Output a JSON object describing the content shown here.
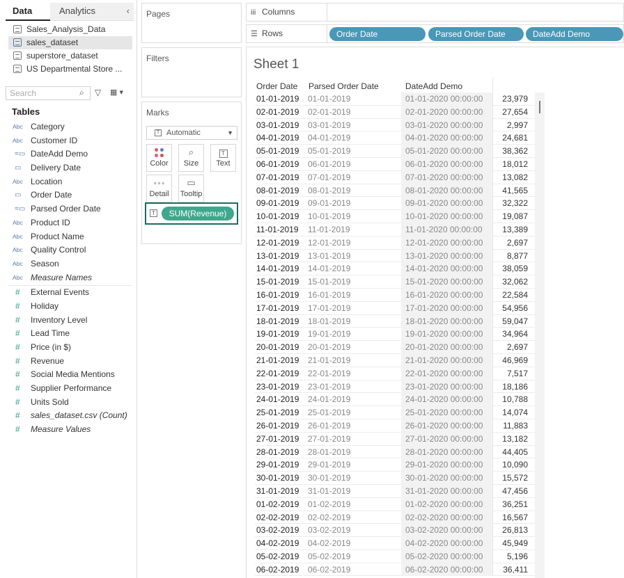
{
  "data_pane": {
    "tab_data": "Data",
    "tab_analytics": "Analytics",
    "collapse_icon": "chevron-left-icon",
    "data_sources": [
      {
        "label": "Sales_Analysis_Data",
        "selected": false
      },
      {
        "label": "sales_dataset",
        "selected": true
      },
      {
        "label": "superstore_dataset",
        "selected": false
      },
      {
        "label": "US Departmental Store ...",
        "selected": false
      }
    ],
    "search_placeholder": "Search",
    "tables_label": "Tables",
    "dimensions": [
      {
        "type": "Abc",
        "label": "Category"
      },
      {
        "type": "Abc",
        "label": "Customer ID"
      },
      {
        "type": "calc-date",
        "label": "DateAdd Demo"
      },
      {
        "type": "date",
        "label": "Delivery Date"
      },
      {
        "type": "Abc",
        "label": "Location"
      },
      {
        "type": "date",
        "label": "Order Date"
      },
      {
        "type": "calc-date",
        "label": "Parsed Order Date"
      },
      {
        "type": "Abc",
        "label": "Product ID"
      },
      {
        "type": "Abc",
        "label": "Product Name"
      },
      {
        "type": "Abc",
        "label": "Quality Control"
      },
      {
        "type": "Abc",
        "label": "Season"
      },
      {
        "type": "Abc",
        "label": "Measure Names",
        "italic": true
      }
    ],
    "measures": [
      {
        "type": "#",
        "label": "External Events"
      },
      {
        "type": "#",
        "label": "Holiday"
      },
      {
        "type": "#",
        "label": "Inventory Level"
      },
      {
        "type": "#",
        "label": "Lead Time"
      },
      {
        "type": "#",
        "label": "Price (in $)"
      },
      {
        "type": "#",
        "label": "Revenue"
      },
      {
        "type": "#",
        "label": "Social Media Mentions"
      },
      {
        "type": "#",
        "label": "Supplier Performance"
      },
      {
        "type": "#",
        "label": "Units Sold"
      },
      {
        "type": "#",
        "label": "sales_dataset.csv (Count)",
        "italic": true
      },
      {
        "type": "#",
        "label": "Measure Values",
        "italic": true
      }
    ]
  },
  "cards": {
    "pages": "Pages",
    "filters": "Filters",
    "marks": "Marks",
    "mark_type": "Automatic",
    "mark_buttons": {
      "color": "Color",
      "size": "Size",
      "text": "Text",
      "detail": "Detail",
      "tooltip": "Tooltip"
    },
    "marks_pill": "SUM(Revenue)"
  },
  "shelves": {
    "columns_label": "Columns",
    "rows_label": "Rows",
    "rows_pills": [
      "Order Date",
      "Parsed Order Date",
      "DateAdd Demo"
    ],
    "pill_color": "#4a97b8"
  },
  "view": {
    "sheet_title": "Sheet 1",
    "headers": [
      "Order Date",
      "Parsed Order Date",
      "DateAdd Demo"
    ],
    "rows": [
      [
        "01-01-2019",
        "01-01-2019",
        "01-01-2020 00:00:00",
        "23,979"
      ],
      [
        "02-01-2019",
        "02-01-2019",
        "02-01-2020 00:00:00",
        "27,654"
      ],
      [
        "03-01-2019",
        "03-01-2019",
        "03-01-2020 00:00:00",
        "2,997"
      ],
      [
        "04-01-2019",
        "04-01-2019",
        "04-01-2020 00:00:00",
        "24,681"
      ],
      [
        "05-01-2019",
        "05-01-2019",
        "05-01-2020 00:00:00",
        "38,362"
      ],
      [
        "06-01-2019",
        "06-01-2019",
        "06-01-2020 00:00:00",
        "18,012"
      ],
      [
        "07-01-2019",
        "07-01-2019",
        "07-01-2020 00:00:00",
        "13,082"
      ],
      [
        "08-01-2019",
        "08-01-2019",
        "08-01-2020 00:00:00",
        "41,565"
      ],
      [
        "09-01-2019",
        "09-01-2019",
        "09-01-2020 00:00:00",
        "32,322"
      ],
      [
        "10-01-2019",
        "10-01-2019",
        "10-01-2020 00:00:00",
        "19,087"
      ],
      [
        "11-01-2019",
        "11-01-2019",
        "11-01-2020 00:00:00",
        "13,389"
      ],
      [
        "12-01-2019",
        "12-01-2019",
        "12-01-2020 00:00:00",
        "2,697"
      ],
      [
        "13-01-2019",
        "13-01-2019",
        "13-01-2020 00:00:00",
        "8,877"
      ],
      [
        "14-01-2019",
        "14-01-2019",
        "14-01-2020 00:00:00",
        "38,059"
      ],
      [
        "15-01-2019",
        "15-01-2019",
        "15-01-2020 00:00:00",
        "32,062"
      ],
      [
        "16-01-2019",
        "16-01-2019",
        "16-01-2020 00:00:00",
        "22,584"
      ],
      [
        "17-01-2019",
        "17-01-2019",
        "17-01-2020 00:00:00",
        "54,956"
      ],
      [
        "18-01-2019",
        "18-01-2019",
        "18-01-2020 00:00:00",
        "59,047"
      ],
      [
        "19-01-2019",
        "19-01-2019",
        "19-01-2020 00:00:00",
        "34,964"
      ],
      [
        "20-01-2019",
        "20-01-2019",
        "20-01-2020 00:00:00",
        "2,697"
      ],
      [
        "21-01-2019",
        "21-01-2019",
        "21-01-2020 00:00:00",
        "46,969"
      ],
      [
        "22-01-2019",
        "22-01-2019",
        "22-01-2020 00:00:00",
        "7,517"
      ],
      [
        "23-01-2019",
        "23-01-2019",
        "23-01-2020 00:00:00",
        "18,186"
      ],
      [
        "24-01-2019",
        "24-01-2019",
        "24-01-2020 00:00:00",
        "10,788"
      ],
      [
        "25-01-2019",
        "25-01-2019",
        "25-01-2020 00:00:00",
        "14,074"
      ],
      [
        "26-01-2019",
        "26-01-2019",
        "26-01-2020 00:00:00",
        "11,883"
      ],
      [
        "27-01-2019",
        "27-01-2019",
        "27-01-2020 00:00:00",
        "13,182"
      ],
      [
        "28-01-2019",
        "28-01-2019",
        "28-01-2020 00:00:00",
        "44,405"
      ],
      [
        "29-01-2019",
        "29-01-2019",
        "29-01-2020 00:00:00",
        "10,090"
      ],
      [
        "30-01-2019",
        "30-01-2019",
        "30-01-2020 00:00:00",
        "15,572"
      ],
      [
        "31-01-2019",
        "31-01-2019",
        "31-01-2020 00:00:00",
        "47,456"
      ],
      [
        "01-02-2019",
        "01-02-2019",
        "01-02-2020 00:00:00",
        "36,251"
      ],
      [
        "02-02-2019",
        "02-02-2019",
        "02-02-2020 00:00:00",
        "16,567"
      ],
      [
        "03-02-2019",
        "03-02-2019",
        "03-02-2020 00:00:00",
        "26,813"
      ],
      [
        "04-02-2019",
        "04-02-2019",
        "04-02-2020 00:00:00",
        "45,949"
      ],
      [
        "05-02-2019",
        "05-02-2019",
        "05-02-2020 00:00:00",
        "5,196"
      ],
      [
        "06-02-2019",
        "06-02-2019",
        "06-02-2020 00:00:00",
        "36,411"
      ]
    ]
  }
}
